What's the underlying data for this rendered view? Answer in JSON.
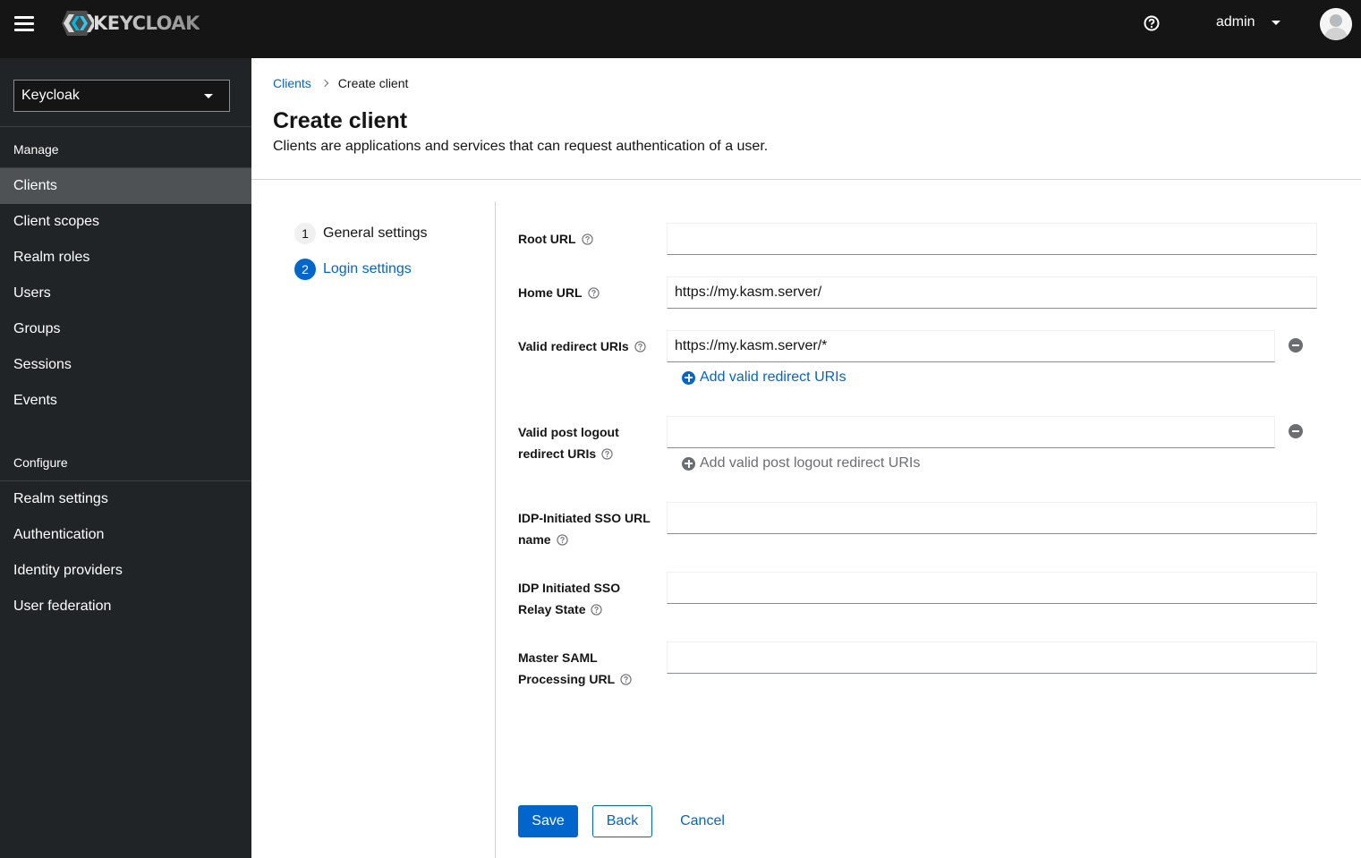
{
  "masthead": {
    "brand": "KEYCLOAK",
    "username": "admin",
    "icons": {
      "menu": "hamburger-icon",
      "help": "question-circle-icon",
      "user_caret": "caret-down-icon",
      "avatar": "user-avatar-icon"
    }
  },
  "sidebar": {
    "realm_selector": {
      "value": "Keycloak"
    },
    "sections": [
      {
        "title": "Manage",
        "items": [
          {
            "label": "Clients",
            "active": true
          },
          {
            "label": "Client scopes",
            "active": false
          },
          {
            "label": "Realm roles",
            "active": false
          },
          {
            "label": "Users",
            "active": false
          },
          {
            "label": "Groups",
            "active": false
          },
          {
            "label": "Sessions",
            "active": false
          },
          {
            "label": "Events",
            "active": false
          }
        ]
      },
      {
        "title": "Configure",
        "items": [
          {
            "label": "Realm settings",
            "active": false
          },
          {
            "label": "Authentication",
            "active": false
          },
          {
            "label": "Identity providers",
            "active": false
          },
          {
            "label": "User federation",
            "active": false
          }
        ]
      }
    ]
  },
  "breadcrumb": [
    {
      "label": "Clients",
      "link": true
    },
    {
      "label": "Create client",
      "link": false
    }
  ],
  "page": {
    "title": "Create client",
    "description": "Clients are applications and services that can request authentication of a user."
  },
  "wizard": {
    "steps": [
      {
        "number": "1",
        "label": "General settings",
        "state": "inactive"
      },
      {
        "number": "2",
        "label": "Login settings",
        "state": "current"
      }
    ]
  },
  "form": {
    "fields": [
      {
        "label": "Root URL",
        "value": ""
      },
      {
        "label": "Home URL",
        "value": "https://my.kasm.server/"
      },
      {
        "label": "Valid redirect URIs",
        "value": "https://my.kasm.server/*",
        "add_label": "Add valid redirect URIs"
      },
      {
        "label_line1": "Valid post logout",
        "label_line2": "redirect URIs",
        "value": "",
        "add_label": "Add valid post logout redirect URIs"
      },
      {
        "label_line1": "IDP-Initiated SSO URL",
        "label_line2": "name",
        "value": ""
      },
      {
        "label_line1": "IDP Initiated SSO",
        "label_line2": "Relay State",
        "value": ""
      },
      {
        "label_line1": "Master SAML",
        "label_line2": "Processing URL",
        "value": ""
      }
    ]
  },
  "actions": {
    "save": "Save",
    "back": "Back",
    "cancel": "Cancel"
  },
  "colors": {
    "primary": "#0066cc",
    "masthead_bg": "#151515",
    "sidebar_bg": "#212427",
    "sidebar_active": "#4f5255"
  }
}
